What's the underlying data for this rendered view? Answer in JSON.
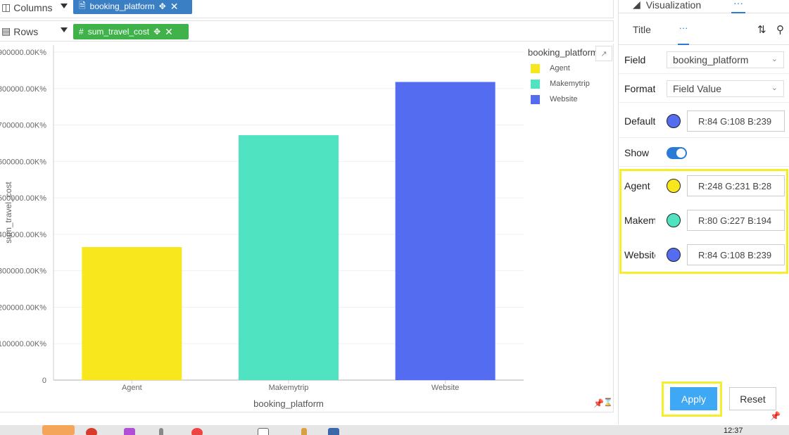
{
  "shelves": {
    "columns": {
      "label": "Columns",
      "pill": "booking_platform"
    },
    "rows": {
      "label": "Rows",
      "pill": "sum_travel_cost"
    }
  },
  "chart_data": {
    "type": "bar",
    "categories": [
      "Agent",
      "Makemytrip",
      "Website"
    ],
    "values": [
      365000,
      672000,
      818000
    ],
    "colors": [
      "#f8e71c",
      "#50e3c2",
      "#546cef"
    ],
    "xlabel": "booking_platform",
    "ylabel": "sum_travel_cost",
    "ylim": [
      0,
      900000
    ],
    "yticks": [
      {
        "value": 0,
        "label": "0"
      },
      {
        "value": 100000,
        "label": "100000.00K%"
      },
      {
        "value": 200000,
        "label": "200000.00K%"
      },
      {
        "value": 300000,
        "label": "300000.00K%"
      },
      {
        "value": 400000,
        "label": "400000.00K%"
      },
      {
        "value": 500000,
        "label": "500000.00K%"
      },
      {
        "value": 600000,
        "label": "600000.00K%"
      },
      {
        "value": 700000,
        "label": "700000.00K%"
      },
      {
        "value": 800000,
        "label": "800000.00K%"
      },
      {
        "value": 900000,
        "label": "900000.00K%"
      }
    ],
    "legend": {
      "title": "booking_platform",
      "placement": "top-right"
    },
    "grid": true
  },
  "panel": {
    "tab_visualization": "Visualization",
    "tab_more": "···",
    "subtab_title": "Title",
    "subtab_more": "···",
    "field": {
      "label": "Field",
      "value": "booking_platform"
    },
    "format": {
      "label": "Format",
      "value": "Field Value"
    },
    "default_color": {
      "label": "Default",
      "color": "#546cef",
      "value": "R:84 G:108 B:239"
    },
    "show": {
      "label": "Show",
      "on": true
    },
    "series_colors": [
      {
        "label": "Agent",
        "color": "#f8e71c",
        "value": "R:248 G:231 B:28"
      },
      {
        "label": "Makemytrip",
        "color": "#50e3c2",
        "value": "R:80 G:227 B:194"
      },
      {
        "label": "Website",
        "color": "#546cef",
        "value": "R:84 G:108 B:239"
      }
    ],
    "apply_label": "Apply",
    "reset_label": "Reset"
  },
  "taskbar": {
    "clock": "12:37"
  }
}
